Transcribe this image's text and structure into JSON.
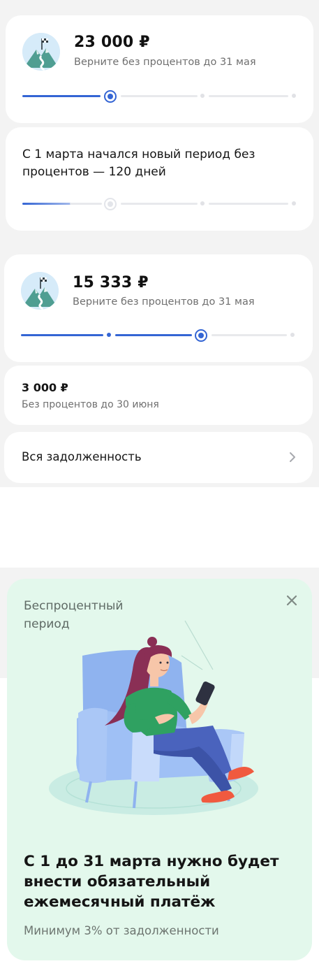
{
  "loan_1": {
    "amount": "23 000 ₽",
    "deadline": "Верните без процентов до 31 мая"
  },
  "period_card": {
    "text": "С 1 марта начался новый период без процентов — 120 дней"
  },
  "loan_2": {
    "amount": "15 333 ₽",
    "deadline": "Верните без процентов до 31 мая"
  },
  "loan_3": {
    "amount": "3 000 ₽",
    "deadline": "Без процентов до 30 июня"
  },
  "debt_row": {
    "label": "Вся задолженность"
  },
  "promo": {
    "title": "Беспроцентный период",
    "headline": "С 1 до 31 марта нужно будет внести обязательный ежемесячный платёж",
    "note": "Минимум 3% от задолженности",
    "close_icon": "close-icon"
  },
  "colors": {
    "accent": "#3465d4",
    "promo_bg": "#e3f8ec",
    "page_bg": "#f3f3f3"
  }
}
